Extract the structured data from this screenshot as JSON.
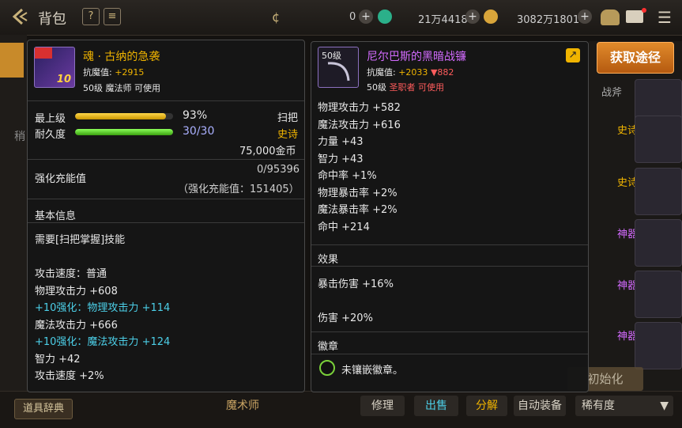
{
  "topbar": {
    "title": "背包",
    "currency_1": "0",
    "currency_2": "21万4418",
    "currency_3": "3082万1801"
  },
  "background": {
    "left_tab": "稍",
    "right_header": "战斧",
    "rarity_labels": [
      "史诗",
      "史诗",
      "神器",
      "神器",
      "神器"
    ],
    "dict_button": "道具辞典",
    "class_name": "魔术师",
    "buttons": {
      "repair": "修理",
      "sell": "出售",
      "disassemble": "分解",
      "auto_equip": "自动装备"
    },
    "rarity_select": "稀有度",
    "init_button": "初始化"
  },
  "left_item": {
    "name": "魂 · 古纳的急袭",
    "anti_magic_label": "抗魔值:",
    "anti_magic_value": "+2915",
    "level_class": "50级 魔法师 可使用",
    "enhance_level": "10",
    "max_level_label": "最上级",
    "max_level_percent": "93%",
    "max_level_fraction": 0.93,
    "category": "扫把",
    "durability_label": "耐久度",
    "durability_value": "30/30",
    "durability_fraction": 1.0,
    "rarity": "史诗",
    "price": "75,000金币",
    "charge_label": "强化充能值",
    "charge_value": "0/95396",
    "charge_note": "（强化充能值：151405）",
    "basic_info_header": "基本信息",
    "skill_req": "需要[扫把掌握]技能",
    "stats": [
      {
        "text": "攻击速度：普通",
        "style": "normal"
      },
      {
        "text": "物理攻击力 +608",
        "style": "normal"
      },
      {
        "text": "+10强化：物理攻击力 +114",
        "style": "cyan"
      },
      {
        "text": "魔法攻击力 +666",
        "style": "normal"
      },
      {
        "text": "+10强化：魔法攻击力 +124",
        "style": "cyan"
      },
      {
        "text": "智力 +42",
        "style": "normal"
      },
      {
        "text": "攻击速度 +2%",
        "style": "normal"
      }
    ]
  },
  "right_item": {
    "level_badge": "50级",
    "name": "尼尔巴斯的黑暗战镰",
    "anti_magic_label": "抗魔值:",
    "anti_magic_value": "+2033",
    "anti_magic_diff": "▼882",
    "level_prefix": "50级",
    "class_req": "圣职者 可使用",
    "stats": [
      "物理攻击力 +582",
      "魔法攻击力 +616",
      "力量 +43",
      "智力 +43",
      "命中率 +1%",
      "物理暴击率 +2%",
      "魔法暴击率 +2%",
      "命中 +214"
    ],
    "effect_header": "效果",
    "effects": [
      "暴击伤害 +16%",
      "伤害 +20%"
    ],
    "emblem_header": "徽章",
    "emblem_text": "未镶嵌徽章。"
  },
  "acquire_button": "获取途径",
  "colors": {
    "gold": "#f0b400",
    "cyan": "#4ccfe8",
    "epic": "#f0b400",
    "artifact": "#d36bff",
    "accent": "#e08a2b"
  }
}
